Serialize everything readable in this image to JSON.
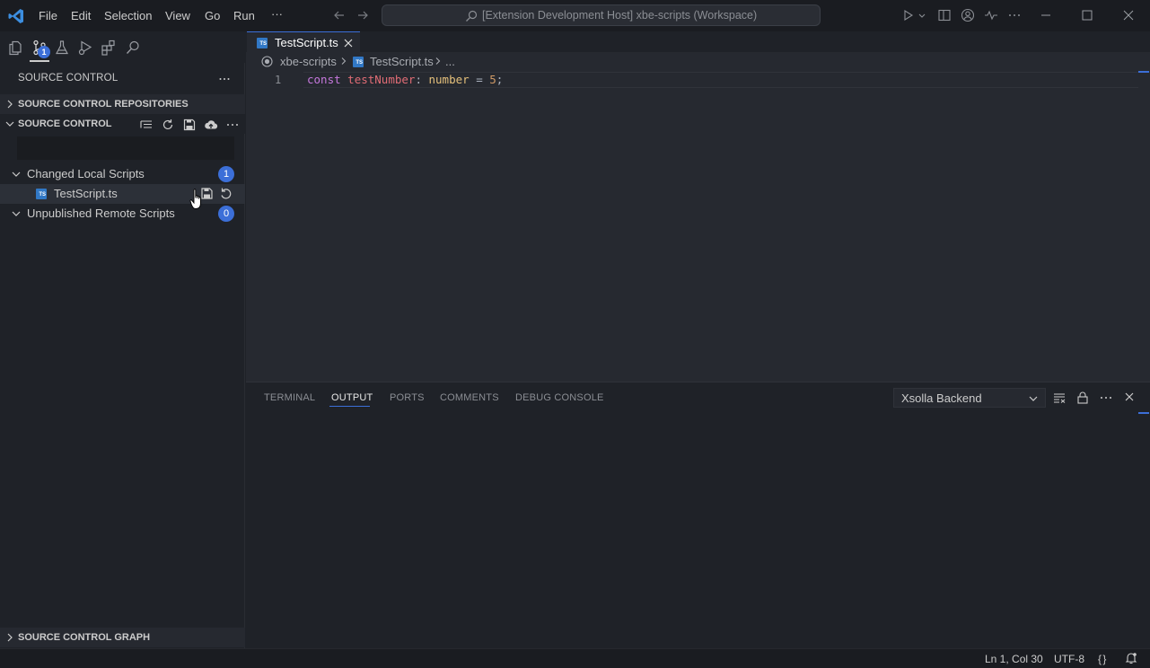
{
  "titlebar": {
    "menu": [
      "File",
      "Edit",
      "Selection",
      "View",
      "Go",
      "Run",
      "···"
    ],
    "command_center": "[Extension Development Host] xbe-scripts (Workspace)"
  },
  "activitybar": {
    "source_control_badge": "1"
  },
  "sidebar": {
    "title": "SOURCE CONTROL",
    "sections": {
      "repositories": "SOURCE CONTROL REPOSITORIES",
      "source_control": "SOURCE CONTROL",
      "graph": "SOURCE CONTROL GRAPH"
    },
    "commit_message_value": "",
    "tree": [
      {
        "label": "Changed Local Scripts",
        "count": "1"
      },
      {
        "label": "TestScript.ts",
        "file_icon": "TS"
      },
      {
        "label": "Unpublished Remote Scripts",
        "count": "0"
      }
    ]
  },
  "editor": {
    "tab": {
      "label": "TestScript.ts",
      "file_icon": "TS"
    },
    "breadcrumbs": [
      "xbe-scripts",
      "TestScript.ts",
      "..."
    ],
    "lines": [
      {
        "number": "1",
        "tokens": {
          "kw": "const",
          "name": "testNumber",
          "colon": ":",
          "type": "number",
          "eq": "=",
          "num": "5",
          "semi": ";"
        }
      }
    ]
  },
  "panel": {
    "tabs": [
      "TERMINAL",
      "OUTPUT",
      "PORTS",
      "COMMENTS",
      "DEBUG CONSOLE"
    ],
    "active_tab": "OUTPUT",
    "output_channel": "Xsolla Backend"
  },
  "statusbar": {
    "position": "Ln 1, Col 30",
    "encoding": "UTF-8",
    "language_braces": "{ }"
  },
  "colors": {
    "accent": "#3c6fd8",
    "ts_icon": "#3178c6"
  }
}
